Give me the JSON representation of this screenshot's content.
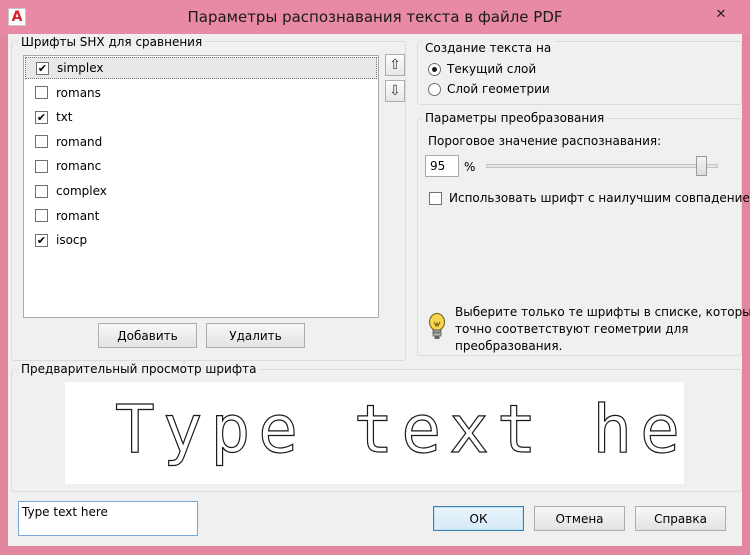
{
  "window": {
    "title": "Параметры распознавания текста в файле PDF",
    "app_icon_letter": "A",
    "close_glyph": "✕"
  },
  "fonts_group": {
    "title": "Шрифты SHX для сравнения",
    "items": [
      {
        "label": "simplex",
        "checked": true,
        "selected": true
      },
      {
        "label": "romans",
        "checked": false,
        "selected": false
      },
      {
        "label": "txt",
        "checked": true,
        "selected": false
      },
      {
        "label": "romand",
        "checked": false,
        "selected": false
      },
      {
        "label": "romanc",
        "checked": false,
        "selected": false
      },
      {
        "label": "complex",
        "checked": false,
        "selected": false
      },
      {
        "label": "romant",
        "checked": false,
        "selected": false
      },
      {
        "label": "isocp",
        "checked": true,
        "selected": false
      }
    ],
    "check_glyph": "✔",
    "move_up_icon": "arrow-up-icon",
    "move_down_icon": "arrow-down-icon",
    "add_label": "Добавить",
    "delete_label": "Удалить"
  },
  "text_creation": {
    "title": "Создание текста на",
    "options": [
      {
        "label": "Текущий слой",
        "selected": true
      },
      {
        "label": "Слой геометрии",
        "selected": false
      }
    ]
  },
  "conversion": {
    "title": "Параметры преобразования",
    "threshold_label": "Пороговое значение распознавания:",
    "threshold_value": "95",
    "threshold_unit": "%",
    "slider_fraction": 0.95,
    "best_match_label": "Использовать шрифт с наилучшим совпадением",
    "best_match_checked": false,
    "hint_icon": "lightbulb-icon",
    "hint_lines": [
      "Выберите только те шрифты в списке, которые",
      "точно соответствуют геометрии для",
      "преобразования."
    ]
  },
  "preview": {
    "title": "Предварительный просмотр шрифта",
    "text": "Type text here"
  },
  "sample": {
    "value": "Type text here"
  },
  "buttons": {
    "ok": "ОК",
    "cancel": "Отмена",
    "help": "Справка"
  }
}
